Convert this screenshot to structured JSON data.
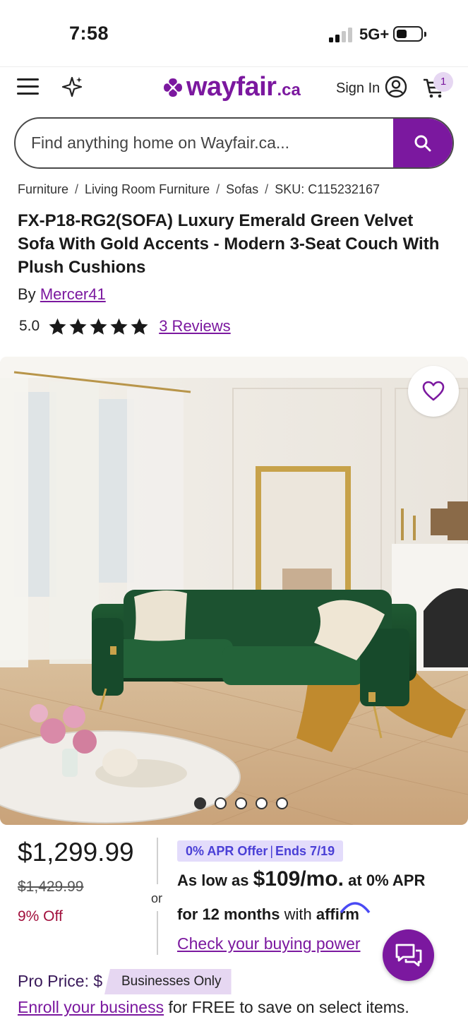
{
  "status_bar": {
    "time": "7:58",
    "network": "5G+"
  },
  "header": {
    "logo_word": "wayfair",
    "logo_tld": ".ca",
    "sign_in": "Sign In",
    "cart_count": "1",
    "brand_color": "#7b189f"
  },
  "search": {
    "placeholder": "Find anything home on Wayfair.ca..."
  },
  "breadcrumb": {
    "items": [
      "Furniture",
      "Living Room Furniture",
      "Sofas"
    ],
    "sku": "SKU: C115232167",
    "separator": "/"
  },
  "product": {
    "title": "FX-P18-RG2(SOFA) Luxury Emerald Green Velvet Sofa With Gold Accents - Modern 3-Seat Couch With Plush Cushions",
    "by_label": "By",
    "brand": "Mercer41",
    "rating": "5.0",
    "stars": 5,
    "reviews": "3 Reviews"
  },
  "gallery": {
    "image_count": 5,
    "active_index": 0
  },
  "pricing": {
    "price": "$1,299.99",
    "was_price": "$1,429.99",
    "discount": "9% Off",
    "or_label": "or",
    "apr_offer": "0% APR Offer",
    "apr_ends": "Ends 7/19",
    "as_low_as": "As low as",
    "monthly": "$109/mo.",
    "at_apr": "at 0% APR",
    "for_months": "for 12 months",
    "with": "with",
    "affirm": "affirm",
    "buying_power": "Check your buying power"
  },
  "pro": {
    "label": "Pro Price:",
    "currency": "$",
    "tag": "Businesses Only",
    "enroll_link": "Enroll your business",
    "enroll_text": "for FREE to save on select items."
  }
}
